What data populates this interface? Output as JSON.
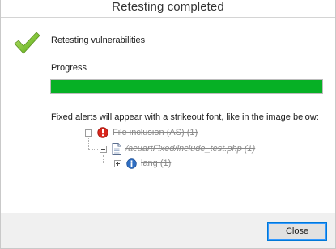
{
  "window": {
    "title": "Retesting completed"
  },
  "status": {
    "icon": "success-checkmark-icon",
    "heading": "Retesting vulnerabilities"
  },
  "progress": {
    "label": "Progress",
    "value_percent": 100,
    "color": "#06b025"
  },
  "note": "Fixed alerts will appear with a strikeout font, like in the image below:",
  "example_tree": {
    "items": [
      {
        "icon": "alert-high-icon",
        "label": "File inclusion (AS) (1)"
      },
      {
        "icon": "file-icon",
        "label": "/acuartFixed/include_test.php (1)"
      },
      {
        "icon": "info-icon",
        "label": "lang (1)"
      }
    ]
  },
  "footer": {
    "close_label": "Close"
  }
}
